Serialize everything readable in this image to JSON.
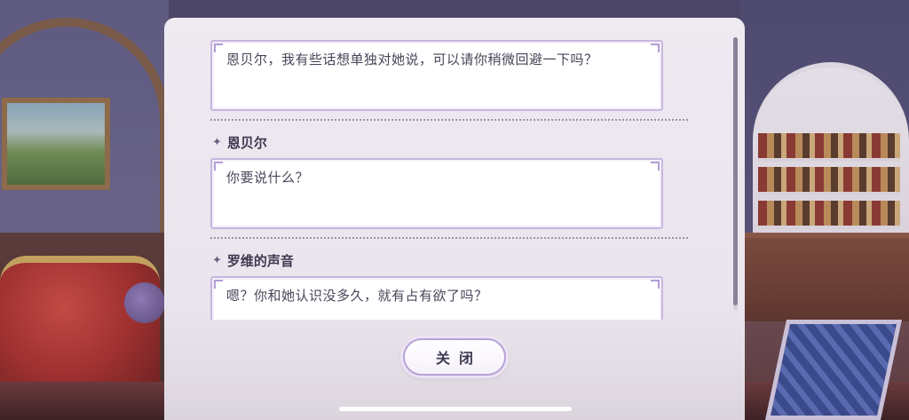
{
  "dialog_log": {
    "entries": [
      {
        "speaker": "",
        "text": "恩贝尔，我有些话想单独对她说，可以请你稍微回避一下吗？"
      },
      {
        "speaker": "恩贝尔",
        "text": "你要说什么？"
      },
      {
        "speaker": "罗维的声音",
        "text": "嗯？你和她认识没多久，就有占有欲了吗？"
      }
    ],
    "speaker_marker": "✦",
    "scroll_position": 0.98
  },
  "close_button": {
    "label": "关闭"
  },
  "colors": {
    "panel_bg": "#f1ecf4",
    "bubble_border": "#c6b6df",
    "text": "#4a4458",
    "speaker_text": "#3e3850"
  }
}
